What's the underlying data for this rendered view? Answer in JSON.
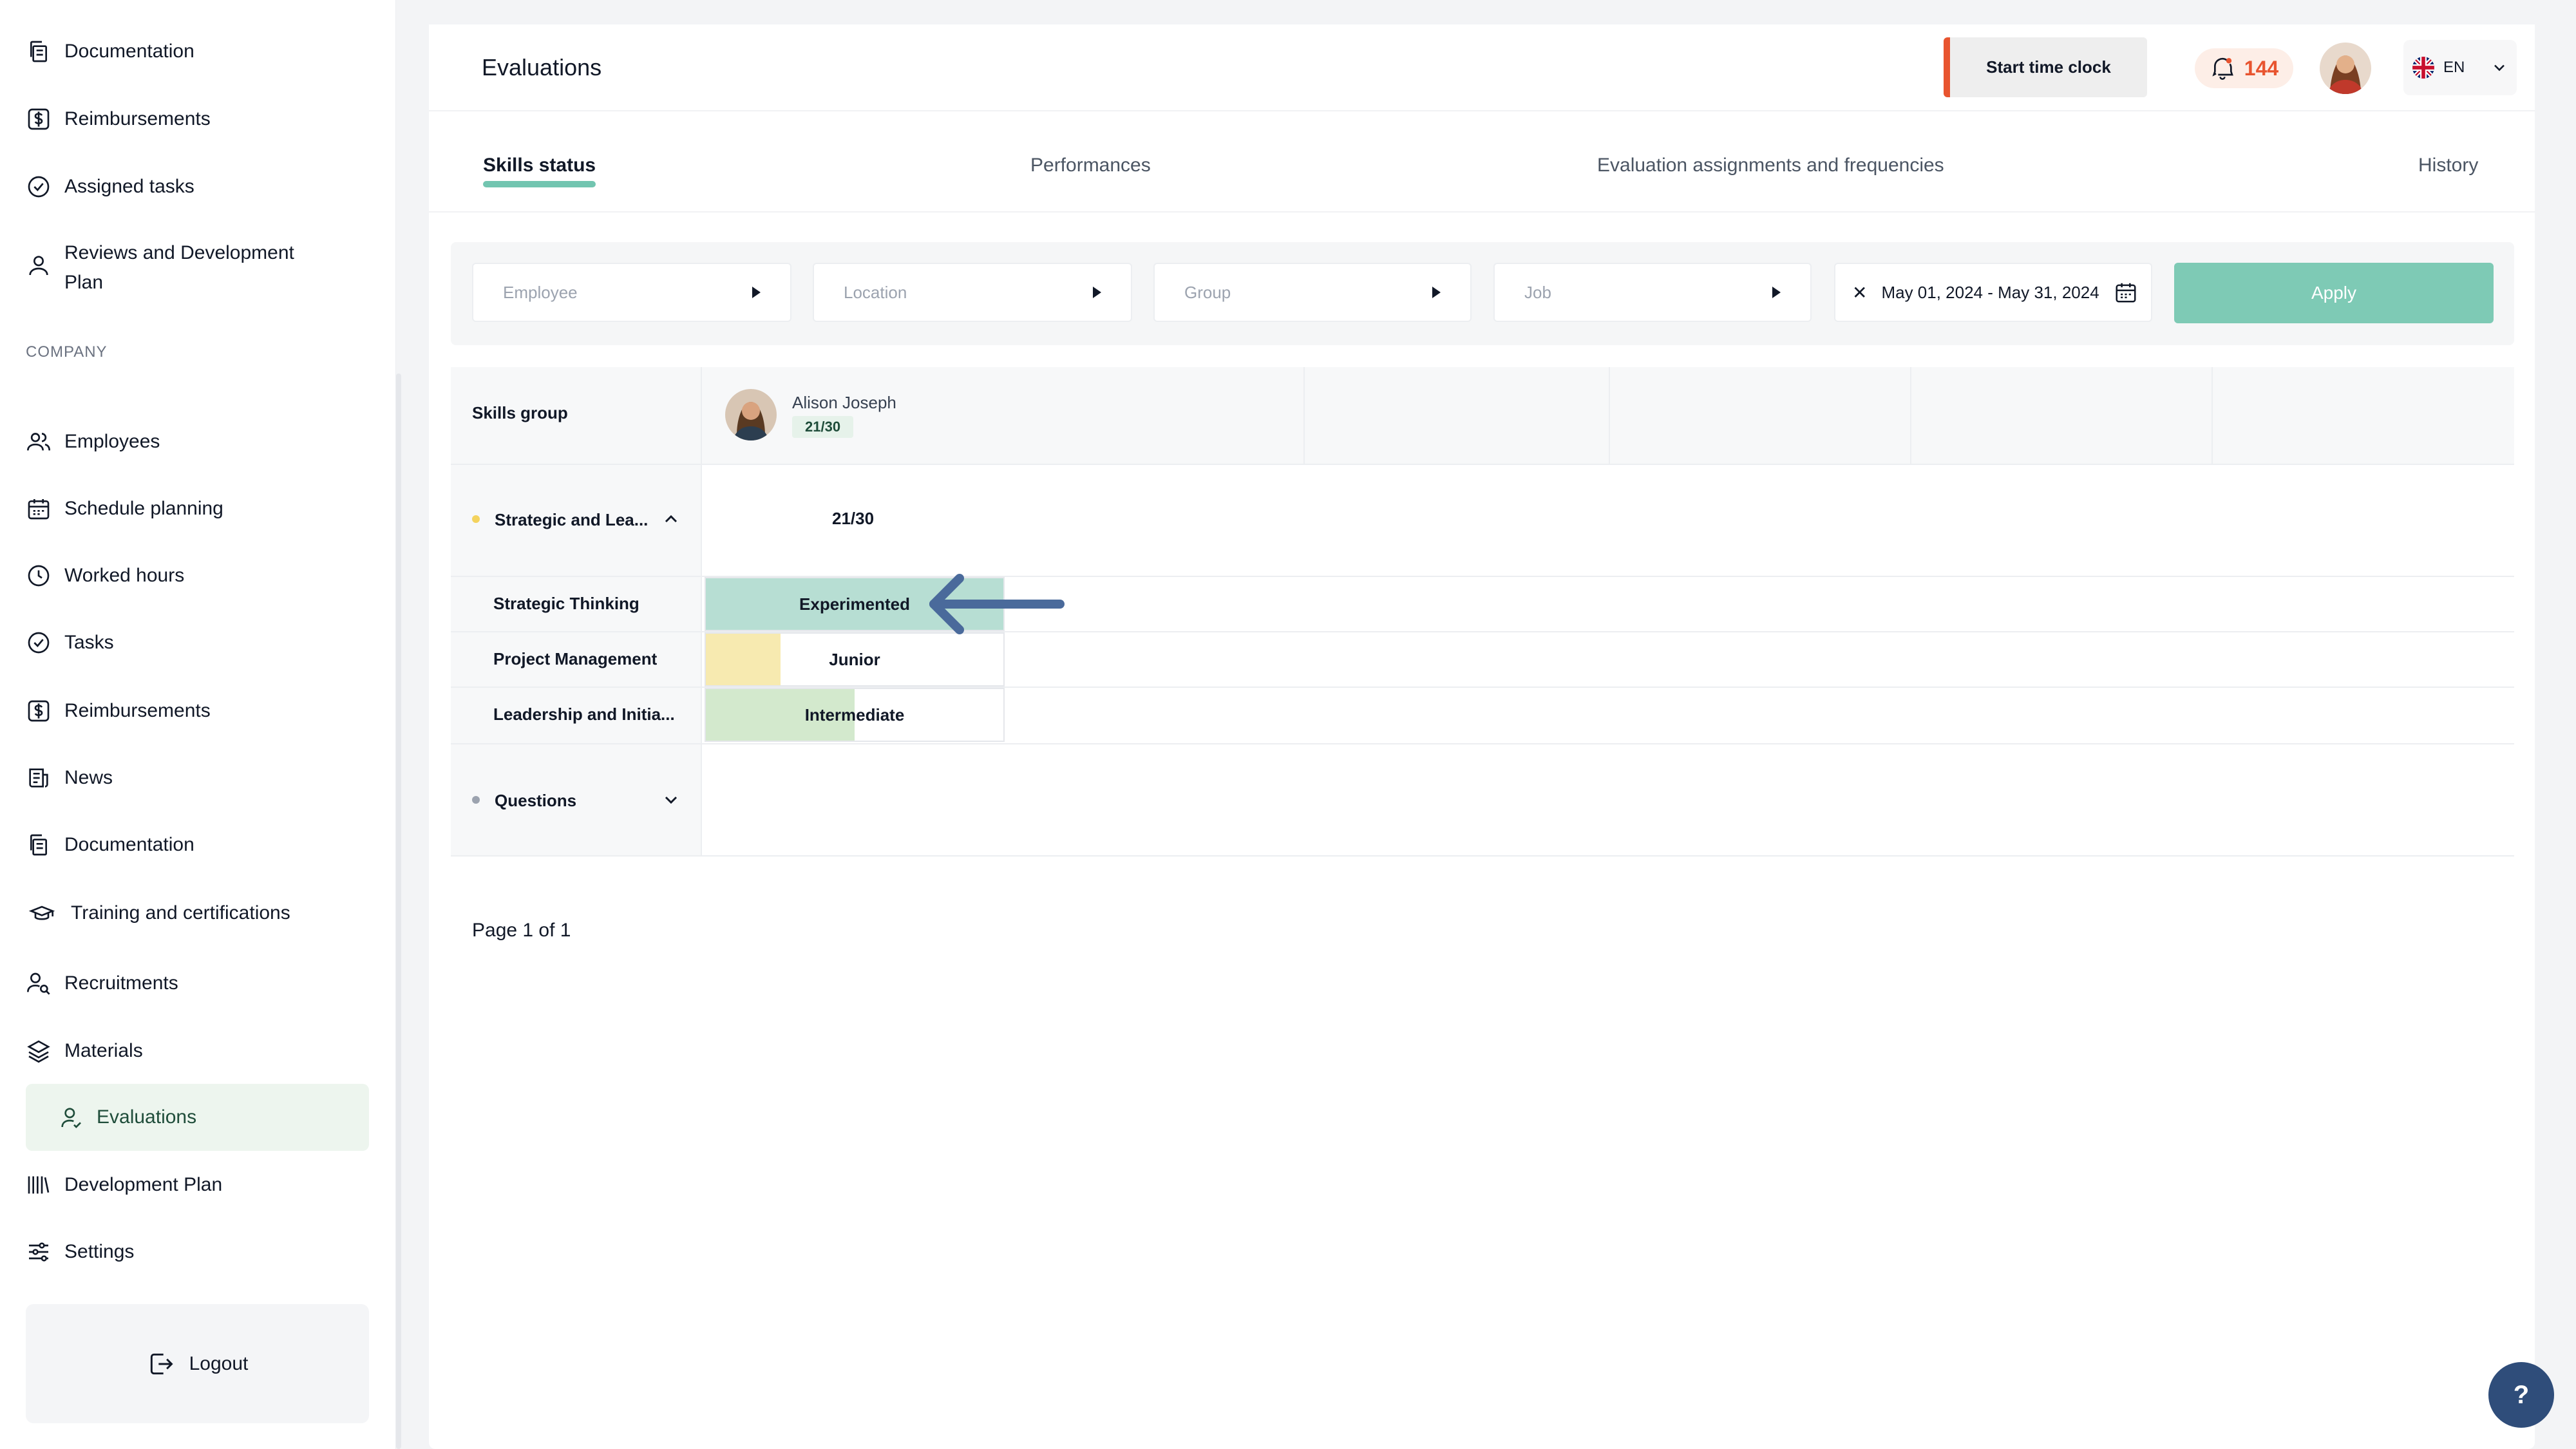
{
  "sidebar": {
    "top_items": [
      {
        "label": "Documentation",
        "icon": "documents-icon"
      },
      {
        "label": "Reimbursements",
        "icon": "dollar-icon"
      },
      {
        "label": "Assigned tasks",
        "icon": "check-circle-icon"
      },
      {
        "label": "Reviews and Development Plan",
        "icon": "user-icon"
      }
    ],
    "section_label": "COMPANY",
    "company_items": [
      {
        "label": "Employees",
        "icon": "users-icon"
      },
      {
        "label": "Schedule planning",
        "icon": "calendar-icon"
      },
      {
        "label": "Worked hours",
        "icon": "clock-icon"
      },
      {
        "label": "Tasks",
        "icon": "check-circle-icon"
      },
      {
        "label": "Reimbursements",
        "icon": "dollar-icon"
      },
      {
        "label": "News",
        "icon": "news-icon"
      },
      {
        "label": "Documentation",
        "icon": "documents-icon"
      },
      {
        "label": "Training and certifications",
        "icon": "graduation-cap-icon"
      },
      {
        "label": "Recruitments",
        "icon": "user-search-icon"
      },
      {
        "label": "Materials",
        "icon": "layers-icon"
      },
      {
        "label": "Evaluations",
        "icon": "user-check-icon",
        "active": true
      },
      {
        "label": "Development Plan",
        "icon": "bars-icon"
      },
      {
        "label": "Settings",
        "icon": "sliders-icon"
      }
    ],
    "logout_label": "Logout"
  },
  "header": {
    "title": "Evaluations",
    "time_clock_label": "Start time clock",
    "notification_count": "144",
    "language": "EN"
  },
  "tabs": [
    {
      "label": "Skills status",
      "active": true
    },
    {
      "label": "Performances"
    },
    {
      "label": "Evaluation assignments and frequencies"
    },
    {
      "label": "History"
    }
  ],
  "filters": {
    "employee_placeholder": "Employee",
    "location_placeholder": "Location",
    "group_placeholder": "Group",
    "job_placeholder": "Job",
    "date_range": "May 01, 2024 - May 31, 2024",
    "apply_label": "Apply"
  },
  "grid": {
    "header_label": "Skills group",
    "employee": {
      "name": "Alison Joseph",
      "score": "21/30"
    },
    "groups": [
      {
        "name": "Strategic and Lea...",
        "score": "21/30",
        "dot_color": "#f4d35e",
        "expanded": true,
        "skills": [
          {
            "name": "Strategic Thinking",
            "level": "Experimented",
            "fill": 1.0,
            "color": "#b7ded3"
          },
          {
            "name": "Project Management",
            "level": "Junior",
            "fill": 0.25,
            "color": "#f7eab0"
          },
          {
            "name": "Leadership and Initia...",
            "level": "Intermediate",
            "fill": 0.5,
            "color": "#d3e9cd"
          }
        ]
      },
      {
        "name": "Questions",
        "dot_color": "#9ca3af",
        "expanded": false
      }
    ]
  },
  "pager": "Page 1 of 1",
  "help_label": "?"
}
